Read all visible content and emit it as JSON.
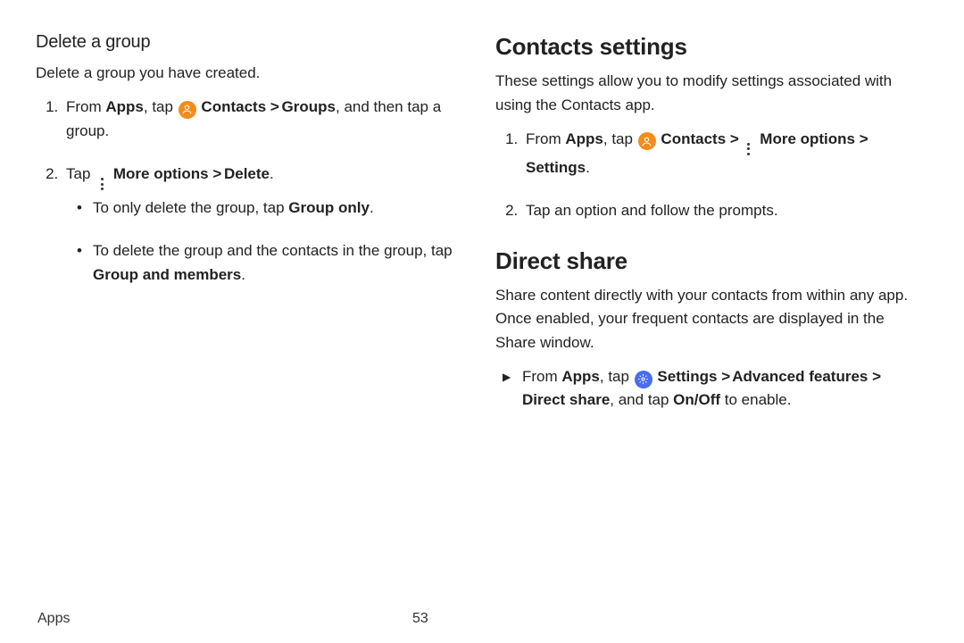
{
  "left": {
    "heading": "Delete a group",
    "intro": "Delete a group you have created.",
    "steps": [
      {
        "pre": "From ",
        "b1": "Apps",
        "mid": ", tap ",
        "icon": "contacts",
        "b2": " Contacts ",
        "chev1": ">",
        "b3": " Groups",
        "post": ", and then tap a group."
      },
      {
        "pre": "Tap ",
        "icon": "more",
        "b1": " More options ",
        "chev1": ">",
        "b2": " Delete",
        "post": "."
      }
    ],
    "bullets": [
      {
        "pre": "To only delete the group, tap ",
        "b1": "Group only",
        "post": "."
      },
      {
        "pre": "To delete the group and the contacts in the group, tap ",
        "b1": "Group and members",
        "post": "."
      }
    ]
  },
  "right": {
    "section1": {
      "heading": "Contacts settings",
      "intro": "These settings allow you to modify settings associated with using the Contacts app.",
      "steps": [
        {
          "pre": "From ",
          "b1": "Apps",
          "mid": ", tap ",
          "icon": "contacts",
          "b2": " Contacts ",
          "chev1": ">",
          "icon2": "more",
          "b3": " More options ",
          "chev2": ">",
          "b4": " Settings",
          "post": "."
        },
        {
          "pre": "Tap an option and follow the prompts."
        }
      ]
    },
    "section2": {
      "heading": "Direct share",
      "intro": "Share content directly with your contacts from within any app. Once enabled, your frequent contacts are displayed in the Share window.",
      "arrow": [
        {
          "pre": "From ",
          "b1": "Apps",
          "mid": ", tap ",
          "icon": "settings",
          "b2": " Settings ",
          "chev1": ">",
          "b3": " Advanced features ",
          "chev2": ">",
          "b4": " Direct share",
          "tail": ", and tap ",
          "b5": "On/Off",
          "post": " to enable."
        }
      ]
    }
  },
  "footer": {
    "section": "Apps",
    "page": "53"
  }
}
